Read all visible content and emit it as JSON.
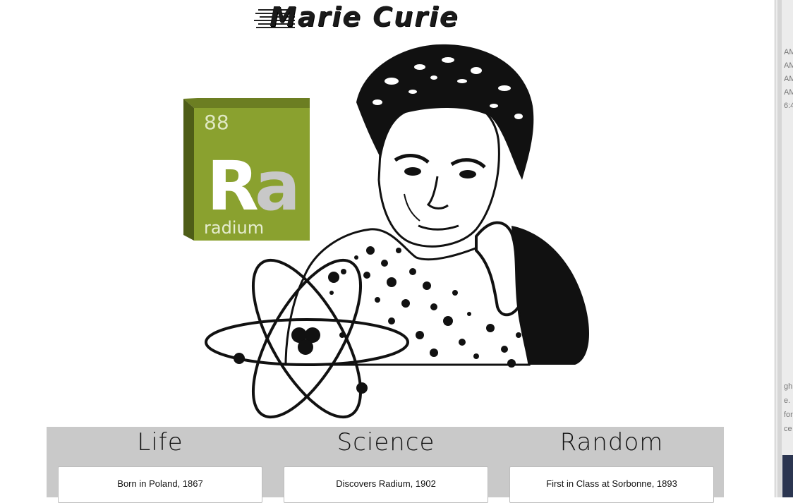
{
  "title": "Marie Curie",
  "element": {
    "number": "88",
    "symbol_r": "R",
    "symbol_a": "a",
    "name": "radium"
  },
  "columns": [
    {
      "heading": "Life",
      "card": "Born in Poland, 1867"
    },
    {
      "heading": "Science",
      "card": "Discovers Radium, 1902"
    },
    {
      "heading": "Random",
      "card": "First in Class at Sorbonne, 1893"
    }
  ],
  "colors": {
    "element_front": "#8aa12f",
    "element_side": "#4e5d17",
    "element_top": "#6c7e22",
    "panel": "#c9c9c9"
  },
  "sidebar_fragments": [
    "AM",
    "AM",
    "AM",
    "AM",
    "6:4",
    "gh",
    "e.",
    "for",
    "ce"
  ]
}
